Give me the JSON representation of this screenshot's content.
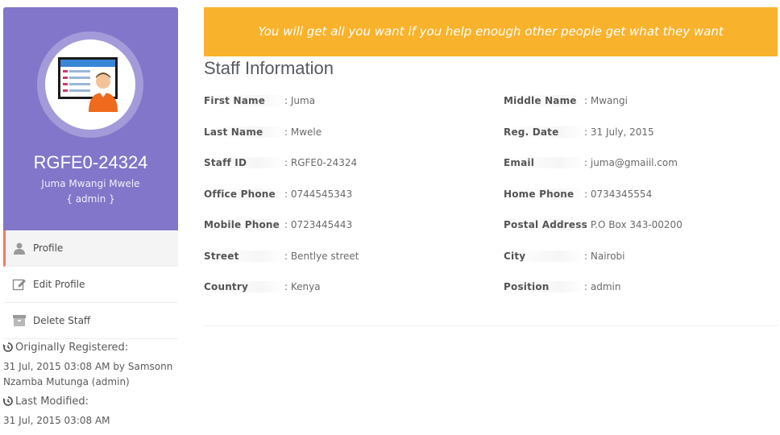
{
  "profile": {
    "staff_code": "RGFE0-24324",
    "full_name": "Juma Mwangi Mwele",
    "role": "{ admin }"
  },
  "menu": [
    {
      "label": "Profile",
      "icon": "user-icon",
      "active": true
    },
    {
      "label": "Edit Profile",
      "icon": "edit-icon",
      "active": false
    },
    {
      "label": "Delete Staff",
      "icon": "archive-icon",
      "active": false
    }
  ],
  "audit": {
    "registered_label": "Originally Registered:",
    "registered_value": "31 Jul, 2015 03:08 AM by Samsonn Nzamba Mutunga (admin)",
    "modified_label": "Last Modified:",
    "modified_value": "31 Jul, 2015 03:08 AM"
  },
  "banner": {
    "quote": "You will get all you want if you help enough other people get what they want"
  },
  "info": {
    "title": "Staff Information",
    "left_fields": [
      {
        "label": "First Name",
        "value": ": Juma"
      },
      {
        "label": "Last Name",
        "value": ": Mwele"
      },
      {
        "label": "Staff ID",
        "value": ": RGFE0-24324"
      },
      {
        "label": "Office Phone",
        "value": ": 0744545343"
      },
      {
        "label": "Mobile Phone",
        "value": ": 0723445443"
      },
      {
        "label": "Street",
        "value": ": Bentlye street"
      },
      {
        "label": "Country",
        "value": ": Kenya"
      }
    ],
    "right_fields": [
      {
        "label": "Middle Name",
        "value": ": Mwangi"
      },
      {
        "label": "Reg. Date",
        "value": ": 31 July, 2015"
      },
      {
        "label": "Email",
        "value": ": juma@gmaiil.com"
      },
      {
        "label": "Home Phone",
        "value": ": 0734345554"
      },
      {
        "label": "Postal Address",
        "value": ": P.O Box 343-00200"
      },
      {
        "label": "City",
        "value": ": Nairobi"
      },
      {
        "label": "Position",
        "value": ": admin"
      }
    ]
  },
  "colors": {
    "profile_bg": "#8176c9",
    "banner_bg": "#f9b22b",
    "active_accent": "#f07a6a"
  }
}
